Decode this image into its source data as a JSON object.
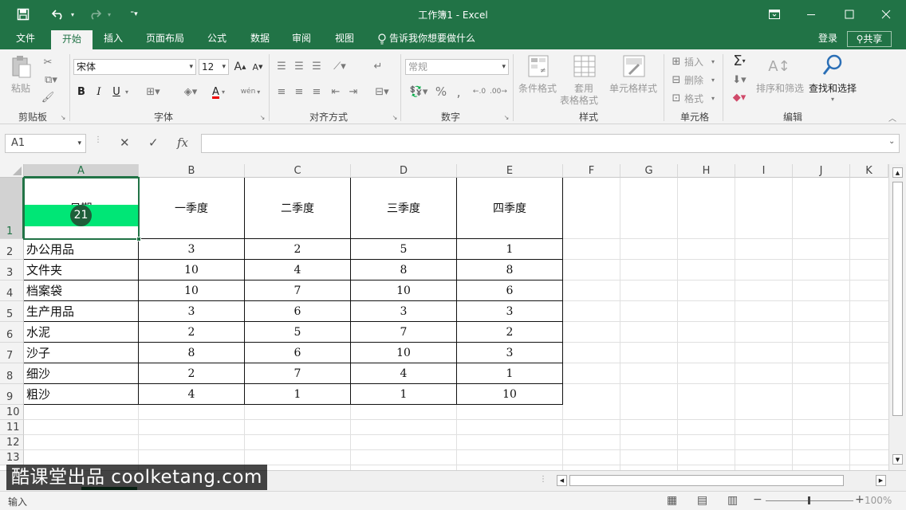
{
  "window": {
    "title": "工作簿1 - Excel",
    "undo_icon": "undo-icon",
    "redo_icon": "redo-icon"
  },
  "tabs": {
    "file": "文件",
    "home": "开始",
    "insert": "插入",
    "page_layout": "页面布局",
    "formulas": "公式",
    "data": "数据",
    "review": "审阅",
    "view": "视图",
    "tell_me": "告诉我你想要做什么",
    "login": "登录",
    "share": "共享"
  },
  "ribbon": {
    "clipboard": {
      "label": "剪贴板",
      "paste": "粘贴"
    },
    "font": {
      "label": "字体",
      "font_name": "宋体",
      "font_size": "12",
      "bold": "B",
      "italic": "I",
      "underline": "U",
      "grow": "A",
      "shrink": "A",
      "font_color": "A",
      "phonetic": "wén"
    },
    "alignment": {
      "label": "对齐方式"
    },
    "number": {
      "label": "数字",
      "format": "常规",
      "percent": "%"
    },
    "styles": {
      "label": "样式",
      "conditional": "条件格式",
      "table_line1": "套用",
      "table_line2": "表格格式",
      "cell_styles": "单元格样式"
    },
    "cells": {
      "label": "单元格",
      "insert": "插入",
      "delete": "删除",
      "format": "格式"
    },
    "editing": {
      "label": "编辑",
      "sort_filter": "排序和筛选",
      "find_select": "查找和选择"
    }
  },
  "formula_bar": {
    "name_box": "A1",
    "cancel": "✕",
    "enter": "✓",
    "fx": "fx",
    "content": ""
  },
  "grid": {
    "columns": [
      "A",
      "B",
      "C",
      "D",
      "E",
      "F",
      "G",
      "H",
      "I",
      "J",
      "K"
    ],
    "rows": [
      "1",
      "2",
      "3",
      "4",
      "5",
      "6",
      "7",
      "8",
      "9",
      "10",
      "11",
      "12",
      "13"
    ],
    "headers": [
      "日期",
      "一季度",
      "二季度",
      "三季度",
      "四季度"
    ],
    "data": [
      [
        "办公用品",
        "3",
        "2",
        "5",
        "1"
      ],
      [
        "文件夹",
        "10",
        "4",
        "8",
        "8"
      ],
      [
        "档案袋",
        "10",
        "7",
        "10",
        "6"
      ],
      [
        "生产用品",
        "3",
        "6",
        "3",
        "3"
      ],
      [
        "水泥",
        "2",
        "5",
        "7",
        "2"
      ],
      [
        "沙子",
        "8",
        "6",
        "10",
        "3"
      ],
      [
        "细沙",
        "2",
        "7",
        "4",
        "1"
      ],
      [
        "粗沙",
        "4",
        "1",
        "1",
        "10"
      ]
    ],
    "selected_cell": "A1",
    "highlight_color": "#00e676",
    "badge": "21"
  },
  "status": {
    "mode": "输入",
    "zoom": "100%"
  },
  "watermark": "酷课堂出品 coolketang.com",
  "colors": {
    "excel_green": "#217346",
    "ribbon_bg": "#f3f3f3",
    "badge_bg": "#1e5e3a"
  }
}
